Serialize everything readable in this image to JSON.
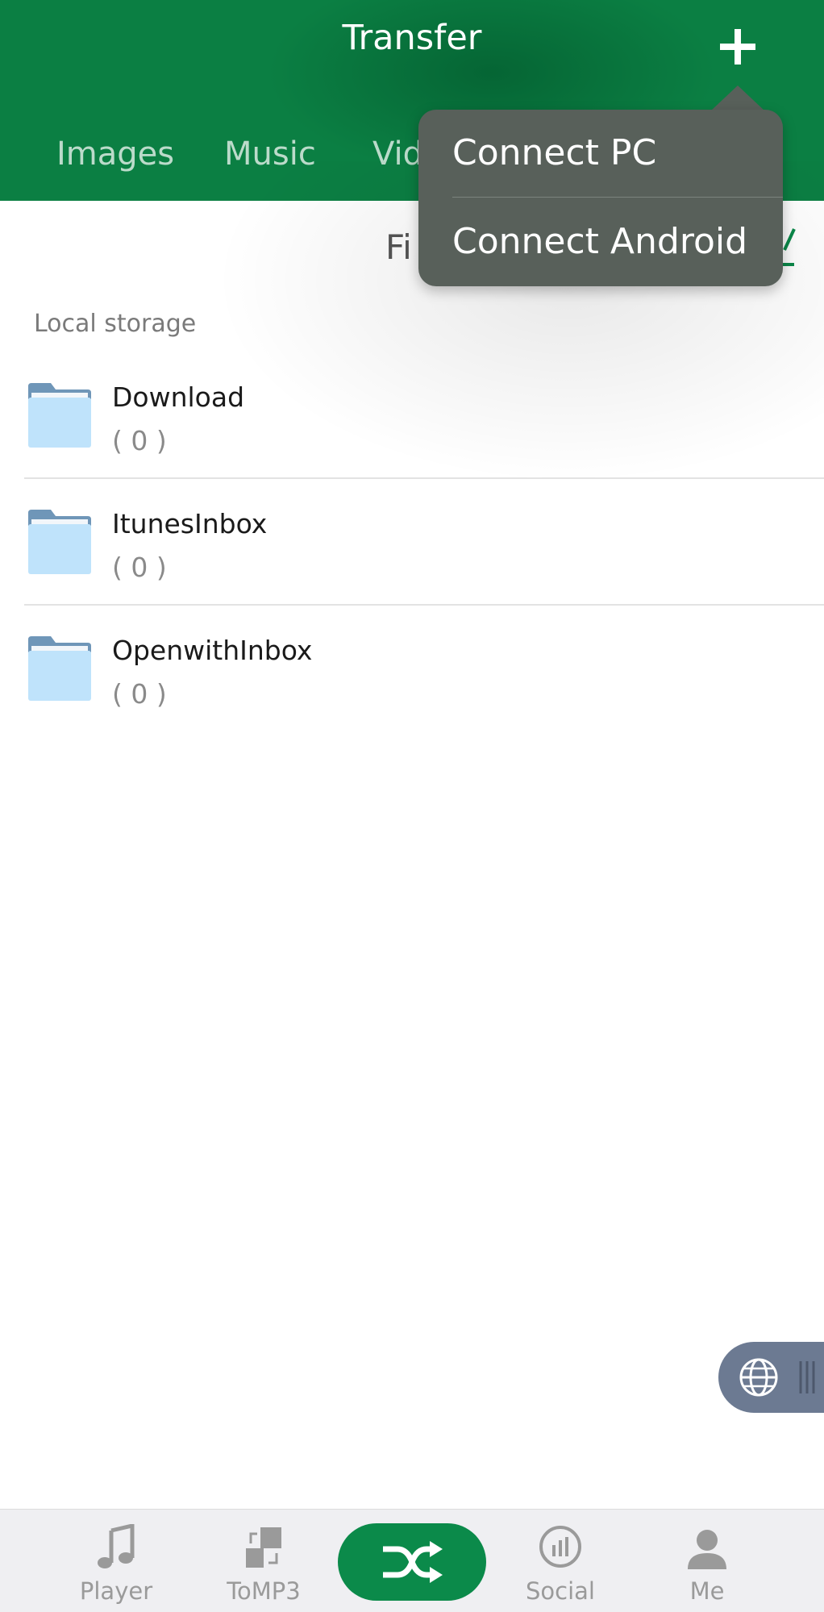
{
  "header": {
    "title": "Transfer",
    "tabs": [
      "Images",
      "Music",
      "Videos"
    ],
    "brand_color": "#0b7f43"
  },
  "toolbar": {
    "partial_label": "Fi"
  },
  "popup_menu": {
    "items": [
      "Connect PC",
      "Connect Android"
    ]
  },
  "storage": {
    "section_label": "Local storage",
    "folders": [
      {
        "name": "Download",
        "count": "( 0 )"
      },
      {
        "name": "ItunesInbox",
        "count": "( 0 )"
      },
      {
        "name": "OpenwithInbox",
        "count": "( 0 )"
      }
    ]
  },
  "floating_widget": {
    "icon": "globe-icon"
  },
  "tabbar": {
    "items": [
      {
        "label": "Player",
        "icon": "music-note-icon"
      },
      {
        "label": "ToMP3",
        "icon": "convert-icon"
      },
      {
        "label": "",
        "icon": "shuffle-icon"
      },
      {
        "label": "Social",
        "icon": "stats-circle-icon"
      },
      {
        "label": "Me",
        "icon": "person-icon"
      }
    ]
  }
}
